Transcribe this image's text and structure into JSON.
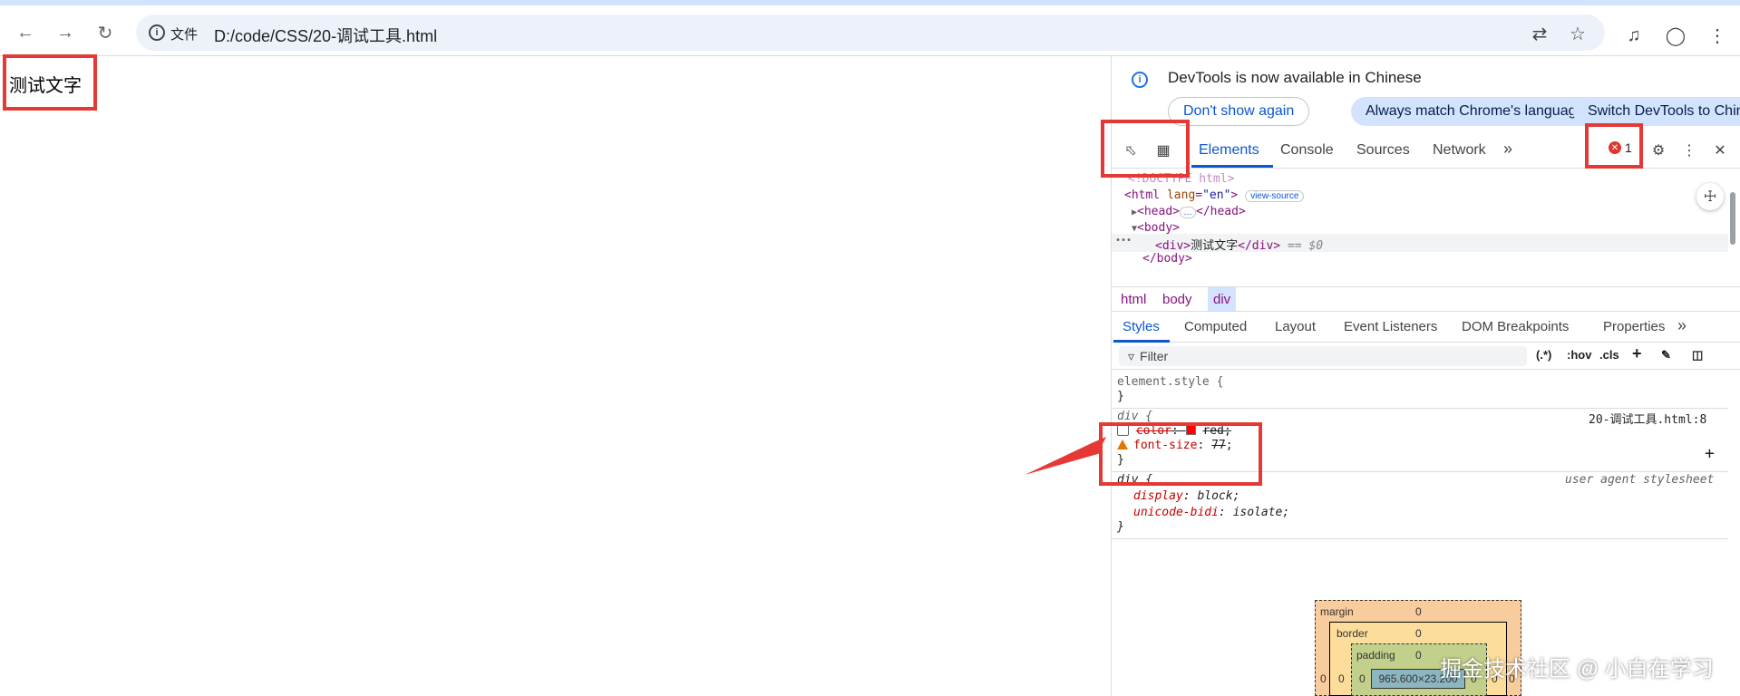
{
  "browser": {
    "url_chip": "文件",
    "url": "D:/code/CSS/20-调试工具.html"
  },
  "page": {
    "text": "测试文字"
  },
  "devtools": {
    "banner": {
      "message": "DevTools is now available in Chinese",
      "btn_dont_show": "Don't show again",
      "btn_match": "Always match Chrome's language",
      "btn_switch": "Switch DevTools to Chin"
    },
    "tabs": [
      "Elements",
      "Console",
      "Sources",
      "Network"
    ],
    "more_tabs": "»",
    "error_count": "1",
    "dom": {
      "doctype": "<!DOCTYPE html>",
      "html_open": "<html",
      "lang_attr": " lang",
      "lang_val": "\"en\"",
      "html_close_bracket": ">",
      "view_source": "view-source",
      "head": "<head>",
      "head_dots": "…",
      "head_close": "</head>",
      "body_open": "<body>",
      "div_open": "<div>",
      "div_text": "测试文字",
      "div_close": "</div>",
      "div_eq": " == $0",
      "row_dots": "•••",
      "body_close": "</body>"
    },
    "breadcrumbs": [
      "html",
      "body",
      "div"
    ],
    "subtabs": [
      "Styles",
      "Computed",
      "Layout",
      "Event Listeners",
      "DOM Breakpoints",
      "Properties"
    ],
    "filter_placeholder": "Filter",
    "filter_tools": [
      ":hov",
      ".cls"
    ],
    "styles": {
      "element_style": "element.style {",
      "close_brace": "}",
      "rule1_selector": "div {",
      "rule1_source": "20-调试工具.html:8",
      "prop_color": "color",
      "val_color": "red",
      "prop_fontsize": "font-size",
      "val_fontsize": "77",
      "rule2_selector": "div {",
      "rule2_source": "user agent stylesheet",
      "prop_display": "display",
      "val_display": "block",
      "prop_bidi": "unicode-bidi",
      "val_bidi": "isolate"
    },
    "box_model": {
      "margin_label": "margin",
      "border_label": "border",
      "padding_label": "padding",
      "zero": "0",
      "content_size": "965.600×23.200"
    }
  },
  "watermark": "掘金技术社区 @ 小白在学习",
  "colors": {
    "annotation_red": "#e53935",
    "accent": "#0b57d0"
  }
}
